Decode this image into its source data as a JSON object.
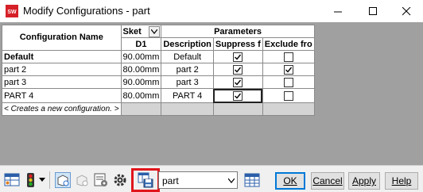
{
  "window": {
    "title": "Modify Configurations - part"
  },
  "table": {
    "header": {
      "config_name": "Configuration Name",
      "sketch_group": "Sket",
      "parameters_group": "Parameters",
      "col_d1": "D1",
      "col_description": "Description",
      "col_suppress": "Suppress f",
      "col_exclude": "Exclude fro"
    },
    "rows": [
      {
        "name": "Default",
        "d1": "90.00mm",
        "description": "Default",
        "suppress": true,
        "exclude": false
      },
      {
        "name": "part 2",
        "d1": "80.00mm",
        "description": "part 2",
        "suppress": true,
        "exclude": true
      },
      {
        "name": "part 3",
        "d1": "90.00mm",
        "description": "part 3",
        "suppress": true,
        "exclude": false
      },
      {
        "name": "PART 4",
        "d1": "80.00mm",
        "description": "PART 4",
        "suppress": true,
        "exclude": false
      }
    ],
    "new_row_label": "< Creates a new configuration. >"
  },
  "toolbar": {
    "view_combo_value": "part",
    "ok_label": "OK",
    "cancel_label": "Cancel",
    "apply_label": "Apply",
    "help_label": "Help"
  },
  "colors": {
    "highlight": "#e0151b",
    "grid_background": "#a0a0a0"
  }
}
